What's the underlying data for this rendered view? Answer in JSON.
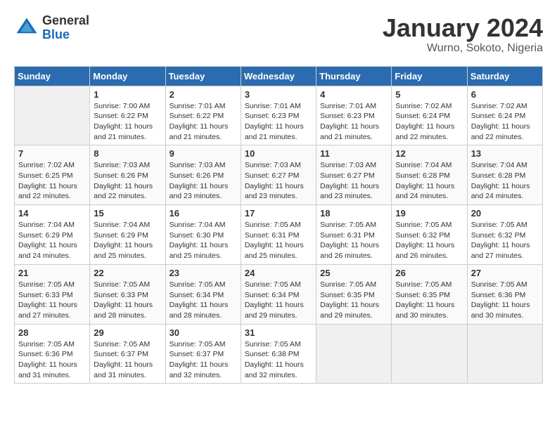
{
  "header": {
    "logo_general": "General",
    "logo_blue": "Blue",
    "title": "January 2024",
    "subtitle": "Wurno, Sokoto, Nigeria"
  },
  "weekdays": [
    "Sunday",
    "Monday",
    "Tuesday",
    "Wednesday",
    "Thursday",
    "Friday",
    "Saturday"
  ],
  "weeks": [
    [
      {
        "day": "",
        "info": ""
      },
      {
        "day": "1",
        "info": "Sunrise: 7:00 AM\nSunset: 6:22 PM\nDaylight: 11 hours\nand 21 minutes."
      },
      {
        "day": "2",
        "info": "Sunrise: 7:01 AM\nSunset: 6:22 PM\nDaylight: 11 hours\nand 21 minutes."
      },
      {
        "day": "3",
        "info": "Sunrise: 7:01 AM\nSunset: 6:23 PM\nDaylight: 11 hours\nand 21 minutes."
      },
      {
        "day": "4",
        "info": "Sunrise: 7:01 AM\nSunset: 6:23 PM\nDaylight: 11 hours\nand 21 minutes."
      },
      {
        "day": "5",
        "info": "Sunrise: 7:02 AM\nSunset: 6:24 PM\nDaylight: 11 hours\nand 22 minutes."
      },
      {
        "day": "6",
        "info": "Sunrise: 7:02 AM\nSunset: 6:24 PM\nDaylight: 11 hours\nand 22 minutes."
      }
    ],
    [
      {
        "day": "7",
        "info": "Sunrise: 7:02 AM\nSunset: 6:25 PM\nDaylight: 11 hours\nand 22 minutes."
      },
      {
        "day": "8",
        "info": "Sunrise: 7:03 AM\nSunset: 6:26 PM\nDaylight: 11 hours\nand 22 minutes."
      },
      {
        "day": "9",
        "info": "Sunrise: 7:03 AM\nSunset: 6:26 PM\nDaylight: 11 hours\nand 23 minutes."
      },
      {
        "day": "10",
        "info": "Sunrise: 7:03 AM\nSunset: 6:27 PM\nDaylight: 11 hours\nand 23 minutes."
      },
      {
        "day": "11",
        "info": "Sunrise: 7:03 AM\nSunset: 6:27 PM\nDaylight: 11 hours\nand 23 minutes."
      },
      {
        "day": "12",
        "info": "Sunrise: 7:04 AM\nSunset: 6:28 PM\nDaylight: 11 hours\nand 24 minutes."
      },
      {
        "day": "13",
        "info": "Sunrise: 7:04 AM\nSunset: 6:28 PM\nDaylight: 11 hours\nand 24 minutes."
      }
    ],
    [
      {
        "day": "14",
        "info": "Sunrise: 7:04 AM\nSunset: 6:29 PM\nDaylight: 11 hours\nand 24 minutes."
      },
      {
        "day": "15",
        "info": "Sunrise: 7:04 AM\nSunset: 6:29 PM\nDaylight: 11 hours\nand 25 minutes."
      },
      {
        "day": "16",
        "info": "Sunrise: 7:04 AM\nSunset: 6:30 PM\nDaylight: 11 hours\nand 25 minutes."
      },
      {
        "day": "17",
        "info": "Sunrise: 7:05 AM\nSunset: 6:31 PM\nDaylight: 11 hours\nand 25 minutes."
      },
      {
        "day": "18",
        "info": "Sunrise: 7:05 AM\nSunset: 6:31 PM\nDaylight: 11 hours\nand 26 minutes."
      },
      {
        "day": "19",
        "info": "Sunrise: 7:05 AM\nSunset: 6:32 PM\nDaylight: 11 hours\nand 26 minutes."
      },
      {
        "day": "20",
        "info": "Sunrise: 7:05 AM\nSunset: 6:32 PM\nDaylight: 11 hours\nand 27 minutes."
      }
    ],
    [
      {
        "day": "21",
        "info": "Sunrise: 7:05 AM\nSunset: 6:33 PM\nDaylight: 11 hours\nand 27 minutes."
      },
      {
        "day": "22",
        "info": "Sunrise: 7:05 AM\nSunset: 6:33 PM\nDaylight: 11 hours\nand 28 minutes."
      },
      {
        "day": "23",
        "info": "Sunrise: 7:05 AM\nSunset: 6:34 PM\nDaylight: 11 hours\nand 28 minutes."
      },
      {
        "day": "24",
        "info": "Sunrise: 7:05 AM\nSunset: 6:34 PM\nDaylight: 11 hours\nand 29 minutes."
      },
      {
        "day": "25",
        "info": "Sunrise: 7:05 AM\nSunset: 6:35 PM\nDaylight: 11 hours\nand 29 minutes."
      },
      {
        "day": "26",
        "info": "Sunrise: 7:05 AM\nSunset: 6:35 PM\nDaylight: 11 hours\nand 30 minutes."
      },
      {
        "day": "27",
        "info": "Sunrise: 7:05 AM\nSunset: 6:36 PM\nDaylight: 11 hours\nand 30 minutes."
      }
    ],
    [
      {
        "day": "28",
        "info": "Sunrise: 7:05 AM\nSunset: 6:36 PM\nDaylight: 11 hours\nand 31 minutes."
      },
      {
        "day": "29",
        "info": "Sunrise: 7:05 AM\nSunset: 6:37 PM\nDaylight: 11 hours\nand 31 minutes."
      },
      {
        "day": "30",
        "info": "Sunrise: 7:05 AM\nSunset: 6:37 PM\nDaylight: 11 hours\nand 32 minutes."
      },
      {
        "day": "31",
        "info": "Sunrise: 7:05 AM\nSunset: 6:38 PM\nDaylight: 11 hours\nand 32 minutes."
      },
      {
        "day": "",
        "info": ""
      },
      {
        "day": "",
        "info": ""
      },
      {
        "day": "",
        "info": ""
      }
    ]
  ],
  "colors": {
    "header_bg": "#2b6cb0",
    "header_text": "#ffffff",
    "border": "#cccccc"
  }
}
